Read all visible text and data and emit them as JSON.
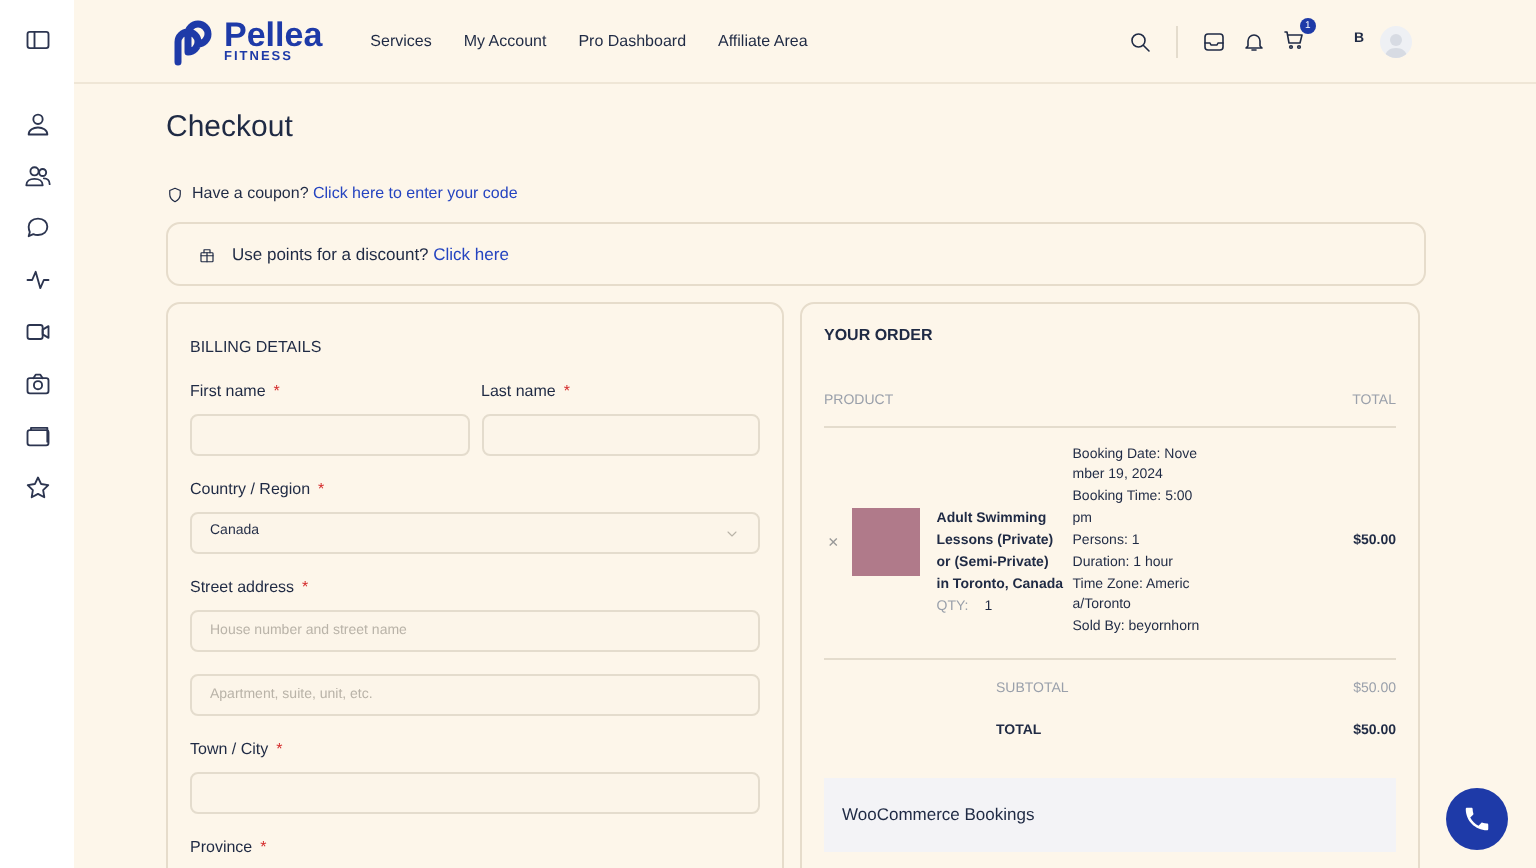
{
  "header": {
    "brand": "Pellea",
    "tagline": "FITNESS",
    "nav": [
      "Services",
      "My Account",
      "Pro Dashboard",
      "Affiliate Area"
    ],
    "cart_count": "1",
    "user_initial": "B"
  },
  "page_title": "Checkout",
  "coupon": {
    "text": "Have a coupon?",
    "link": "Click here to enter your code"
  },
  "points": {
    "text": "Use points for a discount?",
    "link": "Click here"
  },
  "billing": {
    "title": "BILLING DETAILS",
    "rows": [
      [
        {
          "kind": "text",
          "label": "First name",
          "required_mark": "*"
        },
        {
          "kind": "text",
          "label": "Last name",
          "required_mark": "*"
        }
      ],
      [
        {
          "kind": "select",
          "label": "Country / Region",
          "required_mark": "*",
          "value": "Canada"
        }
      ],
      [
        {
          "kind": "text",
          "label": "Street address",
          "required_mark": "*",
          "placeholder": "House number and street name"
        }
      ],
      [
        {
          "kind": "text",
          "placeholder": "Apartment, suite, unit, etc."
        }
      ],
      [
        {
          "kind": "text",
          "label": "Town / City",
          "required_mark": "*"
        }
      ],
      [
        {
          "kind": "label",
          "label": "Province",
          "required_mark": "*"
        }
      ]
    ]
  },
  "order": {
    "title": "YOUR ORDER",
    "columns": [
      "PRODUCT",
      "TOTAL"
    ],
    "items": [
      {
        "remove": "×",
        "name": "Adult Swimming Lessons (Private) or (Semi-Private) in Toronto, Canada",
        "qty_label": "QTY:",
        "qty": "1",
        "meta": [
          "Booking Date: November 19, 2024",
          "Booking Time: 5:00 pm",
          "Persons: 1",
          "Duration: 1 hour",
          "Time Zone: America/Toronto",
          "Sold By: beyornhorn"
        ],
        "total": "$50.00"
      }
    ],
    "subtotal": {
      "label": "SUBTOTAL",
      "value": "$50.00"
    },
    "total": {
      "label": "TOTAL",
      "value": "$50.00"
    },
    "payment_title": "WooCommerce Bookings"
  }
}
